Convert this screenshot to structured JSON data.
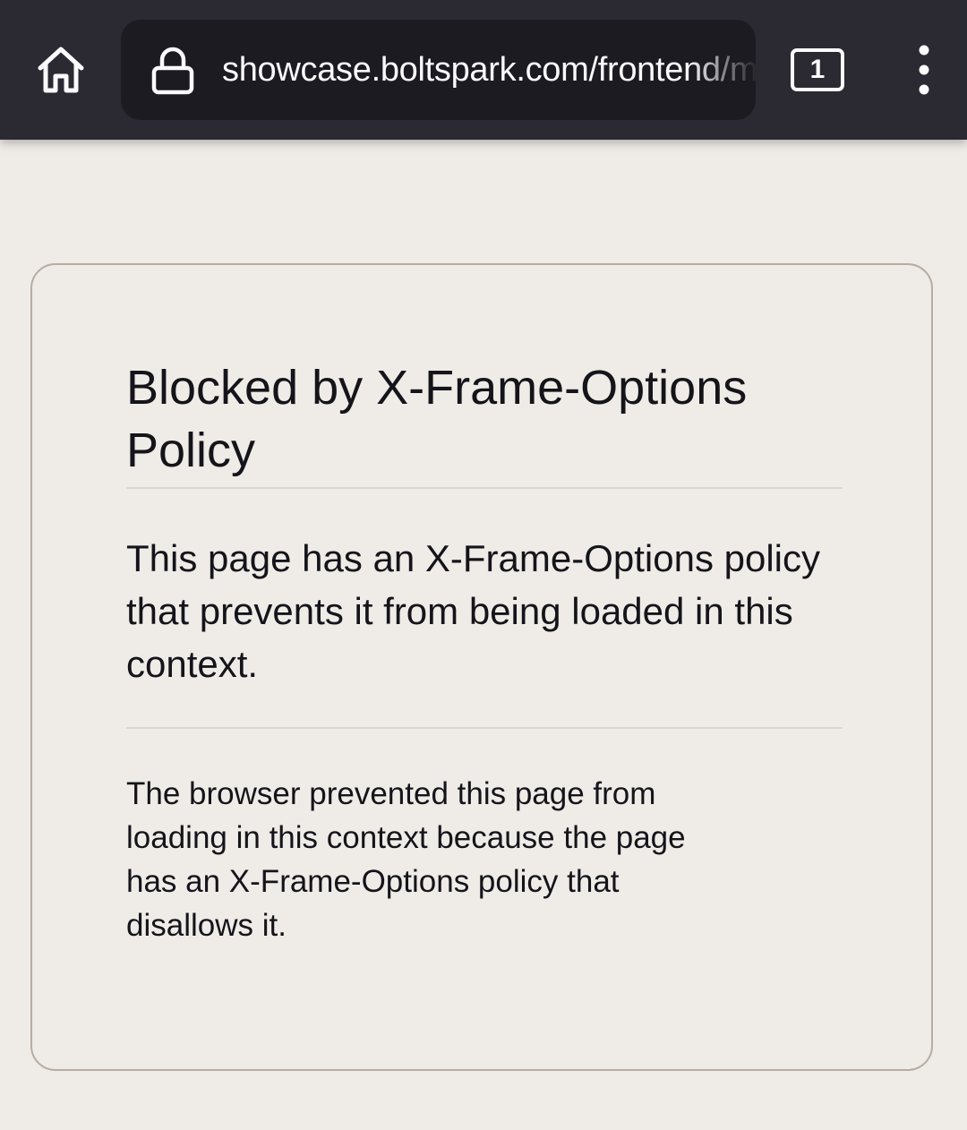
{
  "toolbar": {
    "home_icon": "home-icon",
    "lock_icon": "lock-icon",
    "url": "showcase.boltspark.com/frontend/mobile-x-frame",
    "tab_count": "1",
    "menu_icon": "kebab-menu-icon"
  },
  "error": {
    "title": "Blocked by X-Frame-Options Policy",
    "description": "This page has an X-Frame-Options policy that prevents it from being loaded in this context.",
    "details": "The browser prevented this page from loading in this context because the page has an X-Frame-Options policy that disallows it."
  },
  "colors": {
    "toolbar_bg": "#2b2a33",
    "urlbar_bg": "#1c1b22",
    "page_bg": "#efebe7",
    "card_border": "#b6aca2",
    "text": "#15141a"
  }
}
